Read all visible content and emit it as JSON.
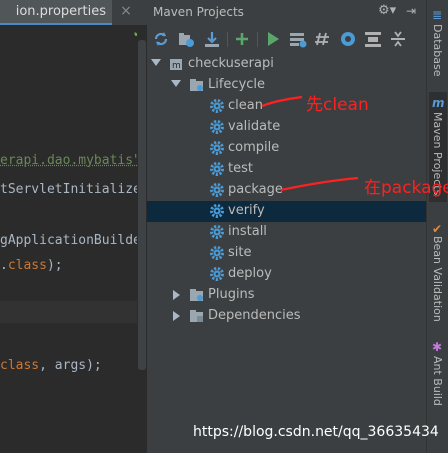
{
  "editor": {
    "tab_name": "ion.properties",
    "tab_close": "×",
    "code_lines": [
      {
        "text": "erapi.dao.mybatis\"",
        "color": "#6a8759"
      },
      {
        "text": "tServletInitialize",
        "color": "#a9b7c6"
      },
      {
        "text": "gApplicationBuilde",
        "color": "#a9b7c6"
      },
      {
        "text_a": ".",
        "text_b": "class",
        "text_c": ");",
        "color_a": "#a9b7c6",
        "color_b": "#cc7832",
        "color_c": "#a9b7c6"
      },
      {
        "text_a": "class",
        "text_b": ", args);",
        "color_a": "#cc7832",
        "color_b": "#a9b7c6"
      }
    ]
  },
  "panel": {
    "title": "Maven Projects",
    "toolbar": [
      "reimport-icon",
      "generate-sources-icon",
      "download-icon",
      "add-icon",
      "run-icon",
      "execute-goal-icon",
      "toggle-offline-icon",
      "skip-tests-icon",
      "show-dependencies-icon",
      "collapse-all-icon",
      "settings-icon"
    ],
    "tree": {
      "project": "checkuserapi",
      "lifecycle": "Lifecycle",
      "goals": [
        "clean",
        "validate",
        "compile",
        "test",
        "package",
        "verify",
        "install",
        "site",
        "deploy"
      ],
      "selected_goal": "verify",
      "plugins": "Plugins",
      "dependencies": "Dependencies"
    }
  },
  "side_tabs": [
    "Database",
    "Maven Projects",
    "Bean Validation",
    "Ant Build"
  ],
  "annotations": {
    "first": "先clean",
    "second": "在package"
  },
  "watermark": "https://blog.csdn.net/qq_36635434",
  "colors": {
    "accent": "#4a88c7",
    "selection": "#0d293e",
    "annotation": "#ff2020",
    "gear": "#4a9bd6"
  }
}
